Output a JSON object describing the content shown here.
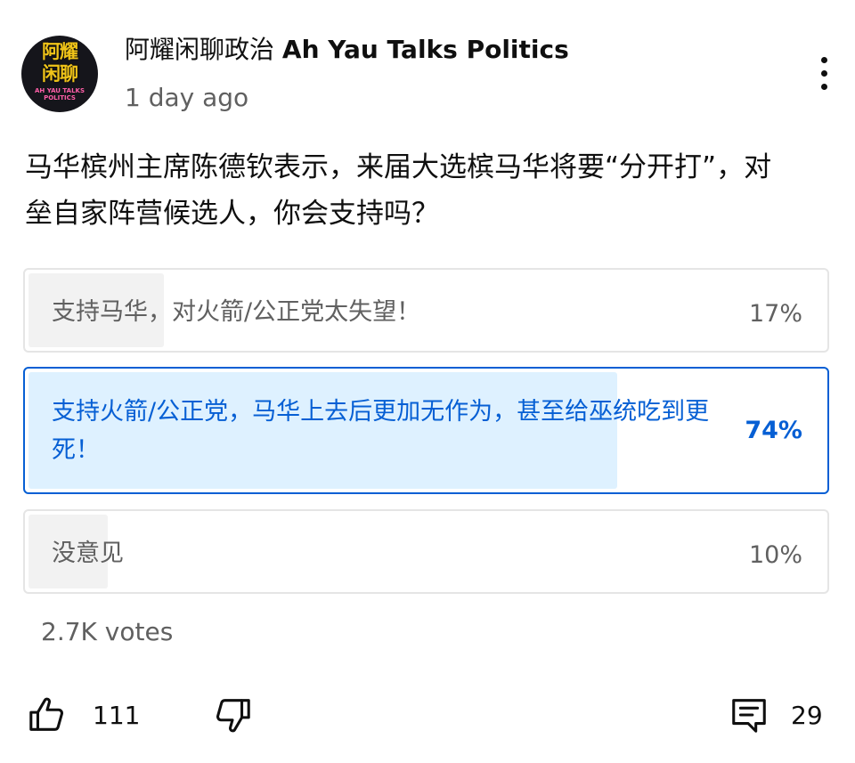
{
  "post": {
    "channel_name_cn": "阿耀闲聊政治",
    "channel_name_en": "Ah Yau Talks Politics",
    "timestamp": "1 day ago",
    "avatar_text_cn_line1": "阿耀",
    "avatar_text_cn_line2": "闲聊",
    "avatar_text_en": "AH YAU TALKS POLITICS",
    "question": "马华槟州主席陈德钦表示，来届大选槟马华将要“分开打”，对垒自家阵营候选人，你会支持吗？"
  },
  "poll": {
    "options": [
      {
        "label": "支持马华，对火箭/公正党太失望！",
        "percent_label": "17%",
        "percent": 17,
        "selected": false
      },
      {
        "label": "支持火箭/公正党，马华上去后更加无作为，甚至给巫统吃到更死！",
        "percent_label": "74%",
        "percent": 74,
        "selected": true
      },
      {
        "label": "没意见",
        "percent_label": "10%",
        "percent": 10,
        "selected": false
      }
    ],
    "votes": "2.7K votes"
  },
  "actions": {
    "like_icon": "thumb-up-icon",
    "likes": "111",
    "dislike_icon": "thumb-down-icon",
    "comment_icon": "comment-icon",
    "comments": "29"
  },
  "colors": {
    "accent": "#065fd4",
    "selected_fill": "#def1ff",
    "unselected_fill": "#f2f2f2",
    "secondary_text": "#606060"
  }
}
